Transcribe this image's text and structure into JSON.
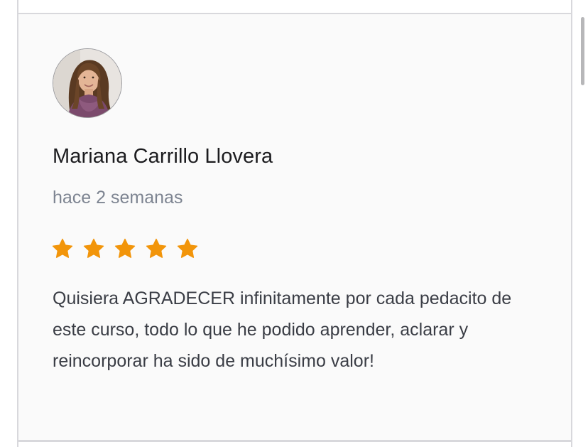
{
  "review": {
    "reviewer_name": "Mariana Carrillo Llovera",
    "date": "hace 2 semanas",
    "rating": 5,
    "rating_max": 5,
    "star_color": "#f2950a",
    "text": "Quisiera AGRADECER infinitamente por cada pedacito de este curso, todo lo que he podido aprender, aclarar y reincorporar ha sido de muchísimo valor!"
  },
  "icons": {
    "avatar": "user-photo",
    "star": "star-icon"
  }
}
